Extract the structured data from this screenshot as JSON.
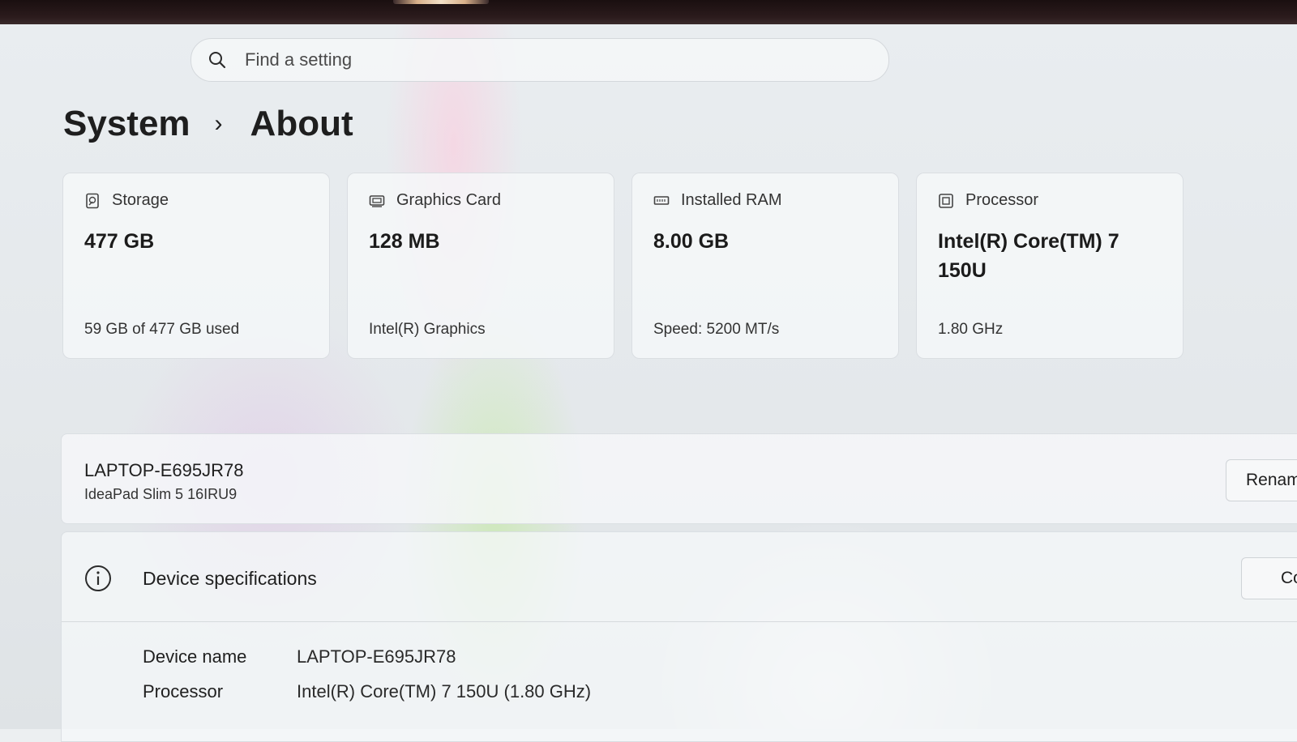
{
  "search": {
    "placeholder": "Find a setting"
  },
  "breadcrumb": {
    "parent": "System",
    "separator": "›",
    "current": "About"
  },
  "cards": [
    {
      "icon": "storage-icon",
      "title": "Storage",
      "value": "477 GB",
      "sub": "59 GB of 477 GB used"
    },
    {
      "icon": "graphics-card-icon",
      "title": "Graphics Card",
      "value": "128 MB",
      "sub": "Intel(R) Graphics"
    },
    {
      "icon": "ram-icon",
      "title": "Installed RAM",
      "value": "8.00 GB",
      "sub": "Speed: 5200 MT/s"
    },
    {
      "icon": "processor-icon",
      "title": "Processor",
      "value": "Intel(R) Core(TM) 7 150U",
      "sub": "1.80 GHz"
    }
  ],
  "device": {
    "name": "LAPTOP-E695JR78",
    "model": "IdeaPad Slim 5 16IRU9",
    "rename_label": "Renam"
  },
  "specs": {
    "title": "Device specifications",
    "copy_label": "Co",
    "rows": [
      {
        "label": "Device name",
        "value": "LAPTOP-E695JR78"
      },
      {
        "label": "Processor",
        "value": "Intel(R) Core(TM) 7 150U (1.80 GHz)"
      }
    ]
  }
}
